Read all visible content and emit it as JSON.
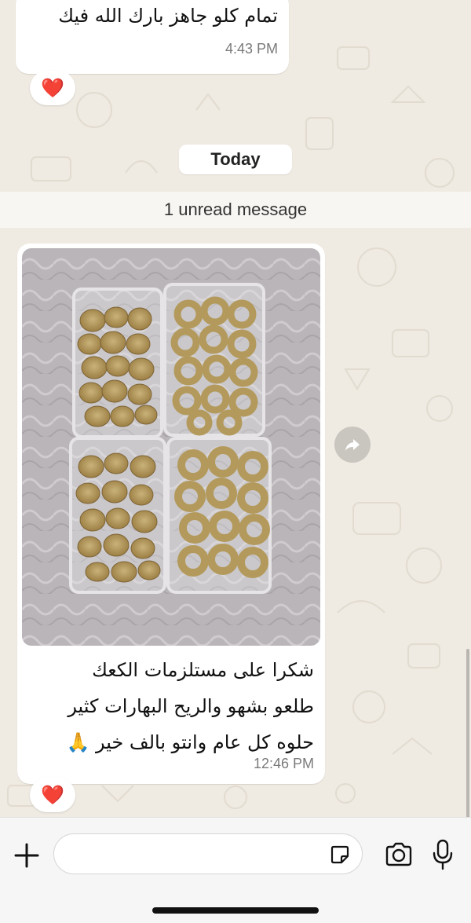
{
  "chat": {
    "messages": [
      {
        "text": "تمام كلو جاهز بارك الله فيك",
        "time": "4:43 PM",
        "reaction": "❤️"
      },
      {
        "image": "photo of cookies (ka'ak and ma'amoul) in four plastic containers",
        "caption_lines": [
          "شكرا على مستلزمات الكعك",
          "طلعو بشهو والريح البهارات كثير",
          "حلوه كل عام وانتو بالف خير 🙏"
        ],
        "time": "12:46 PM",
        "reaction": "❤️"
      }
    ],
    "date_separator": "Today",
    "unread_banner": "1 unread message"
  },
  "composer": {
    "input_value": "",
    "icons": {
      "attach": "plus-icon",
      "sticker": "sticker-icon",
      "camera": "camera-icon",
      "mic": "microphone-icon",
      "forward": "forward-icon"
    }
  },
  "colors": {
    "wallpaper": "#efeae2",
    "bubble": "#ffffff",
    "time_text": "#7a7a7a",
    "heart": "#e0192f"
  }
}
